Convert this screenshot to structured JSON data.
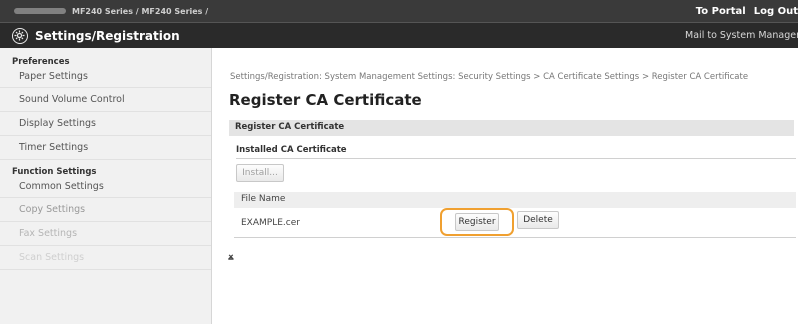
{
  "topbar": {
    "device_series": "MF240 Series / MF240 Series /",
    "portal_link": "To Portal",
    "logout_link": "Log Out"
  },
  "header": {
    "title": "Settings/Registration",
    "mail_link": "Mail to System Manager"
  },
  "sidebar": {
    "preferences_heading": "Preferences",
    "preferences_items": [
      {
        "label": "Paper Settings"
      },
      {
        "label": "Sound Volume Control"
      },
      {
        "label": "Display Settings"
      },
      {
        "label": "Timer Settings"
      }
    ],
    "function_heading": "Function Settings",
    "function_items": [
      {
        "label": "Common Settings"
      },
      {
        "label": "Copy Settings"
      },
      {
        "label": "Fax Settings"
      },
      {
        "label": "Scan Settings"
      }
    ]
  },
  "main": {
    "breadcrumb": "Settings/Registration: System Management Settings: Security Settings > CA Certificate Settings > Register CA Certificate",
    "page_title": "Register CA Certificate",
    "section_title": "Register CA Certificate",
    "installed_heading": "Installed CA Certificate",
    "install_button": "Install...",
    "table": {
      "column_header": "File Name",
      "rows": [
        {
          "file_name": "EXAMPLE.cer",
          "register_label": "Register",
          "delete_label": "Delete"
        }
      ]
    },
    "to_top_icon": "to-top-icon",
    "to_top_glyph": "⨱"
  },
  "colors": {
    "topbar": "#3a3a3a",
    "titlebar": "#2a2a2a",
    "sidebar": "#f1f1f1",
    "highlight": "#f0a030"
  }
}
